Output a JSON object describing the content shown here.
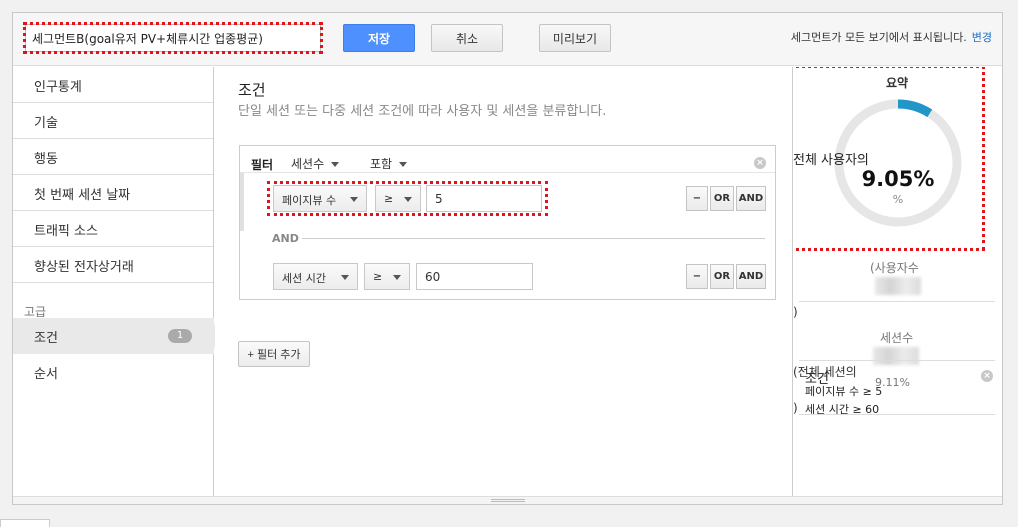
{
  "header": {
    "segment_name": "세그먼트B(goal유저 PV+체류시간 업종평균)",
    "save_label": "저장",
    "cancel_label": "취소",
    "preview_label": "미리보기",
    "visibility_note": "세그먼트가 모든 보기에서 표시됩니다.",
    "change_link": "변경"
  },
  "sidebar": {
    "items": [
      {
        "label": "인구통계"
      },
      {
        "label": "기술"
      },
      {
        "label": "행동"
      },
      {
        "label": "첫 번째 세션 날짜"
      },
      {
        "label": "트래픽 소스"
      },
      {
        "label": "향상된 전자상거래"
      }
    ],
    "advanced_section": "고급",
    "advanced_items": [
      {
        "label": "조건",
        "badge": "1",
        "selected": true
      },
      {
        "label": "순서"
      }
    ]
  },
  "main": {
    "title": "조건",
    "subtitle": "단일 세션 또는 다중 세션 조건에 따라 사용자 및 세션을 분류합니다.",
    "filter": {
      "label": "필터",
      "scope": "세션수",
      "mode": "포함",
      "rows": [
        {
          "dimension": "페이지뷰 수",
          "operator": "≥",
          "value": "5"
        },
        {
          "dimension": "세션 시간",
          "operator": "≥",
          "value": "60"
        }
      ],
      "and_label": "AND",
      "minus_label": "−",
      "or_label": "OR",
      "and_btn_label": "AND"
    },
    "add_filter_label": "+ 필터 추가"
  },
  "summary": {
    "title": "요약",
    "pct_label": "전체 사용자의",
    "pct_value": "9.05%",
    "pct_fraction": 0.0905,
    "pct_unit": "%",
    "users_label": "(사용자수",
    "paren_close_1": ")",
    "sessions_label": "세션수",
    "sessions_pct_label": "(전체 세션의",
    "sessions_pct_value": "9.11%",
    "paren_close_2": ")",
    "overlay_title": "조건",
    "overlay_line1": "페이지뷰 수 ≥ 5",
    "overlay_line2": "세션 시간 ≥ 60"
  },
  "colors": {
    "accent_blue": "#4d90fe",
    "donut_fill": "#2196c9",
    "donut_track": "#e6e6e6",
    "highlight_dash": "#e0141a"
  }
}
